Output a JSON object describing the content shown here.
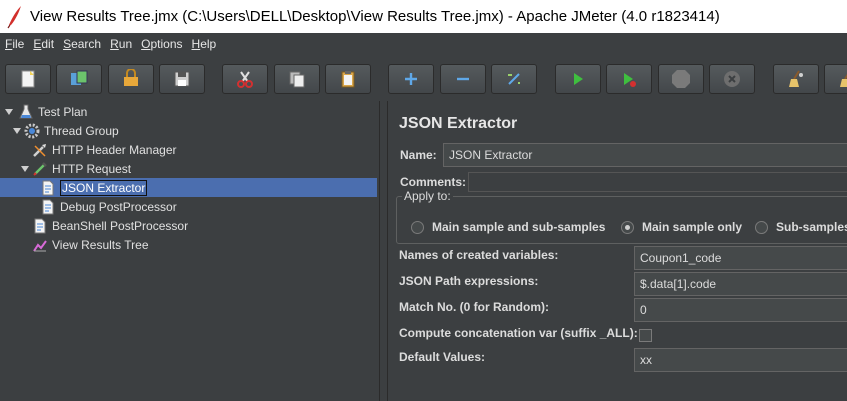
{
  "window": {
    "title": "View Results Tree.jmx (C:\\Users\\DELL\\Desktop\\View Results Tree.jmx) - Apache JMeter (4.0 r1823414)"
  },
  "menu": [
    {
      "label": "File",
      "mnemonic": "F",
      "rest": "ile"
    },
    {
      "label": "Edit",
      "mnemonic": "E",
      "rest": "dit"
    },
    {
      "label": "Search",
      "mnemonic": "S",
      "rest": "earch"
    },
    {
      "label": "Run",
      "mnemonic": "R",
      "rest": "un"
    },
    {
      "label": "Options",
      "mnemonic": "O",
      "rest": "ptions"
    },
    {
      "label": "Help",
      "mnemonic": "H",
      "rest": "elp"
    }
  ],
  "toolbar": [
    {
      "name": "new-icon"
    },
    {
      "name": "templates-icon"
    },
    {
      "name": "open-icon"
    },
    {
      "name": "save-icon"
    },
    {
      "name": "cut-icon"
    },
    {
      "name": "copy-icon"
    },
    {
      "name": "paste-icon"
    },
    {
      "name": "expand-icon"
    },
    {
      "name": "collapse-icon"
    },
    {
      "name": "toggle-icon"
    },
    {
      "name": "start-icon"
    },
    {
      "name": "start-no-pause-icon"
    },
    {
      "name": "stop-icon"
    },
    {
      "name": "shutdown-icon"
    },
    {
      "name": "clear-icon"
    },
    {
      "name": "clear-all-icon"
    }
  ],
  "tree": [
    {
      "label": "Test Plan",
      "icon": "flask-icon"
    },
    {
      "label": "Thread Group",
      "icon": "gear-icon"
    },
    {
      "label": "HTTP Header Manager",
      "icon": "wrench-icon"
    },
    {
      "label": "HTTP Request",
      "icon": "pipette-icon"
    },
    {
      "label": "JSON Extractor",
      "icon": "document-icon"
    },
    {
      "label": "Debug PostProcessor",
      "icon": "document-icon"
    },
    {
      "label": "BeanShell PostProcessor",
      "icon": "document-icon"
    },
    {
      "label": "View Results Tree",
      "icon": "chart-icon"
    }
  ],
  "panel": {
    "title": "JSON Extractor",
    "name_label": "Name:",
    "name_value": "JSON Extractor",
    "comments_label": "Comments:",
    "comments_value": "",
    "apply_to_label": "Apply to:",
    "apply_options": [
      {
        "label": "Main sample and sub-samples",
        "selected": false
      },
      {
        "label": "Main sample only",
        "selected": true
      },
      {
        "label": "Sub-samples only",
        "selected": false
      }
    ],
    "fields": [
      {
        "label": "Names of created variables:",
        "value": "Coupon1_code"
      },
      {
        "label": "JSON Path expressions:",
        "value": "$.data[1].code"
      },
      {
        "label": "Match No. (0 for Random):",
        "value": "0"
      }
    ],
    "concat_label": "Compute concatenation var (suffix _ALL):",
    "concat_checked": false,
    "default_label": "Default Values:",
    "default_value": "xx"
  }
}
